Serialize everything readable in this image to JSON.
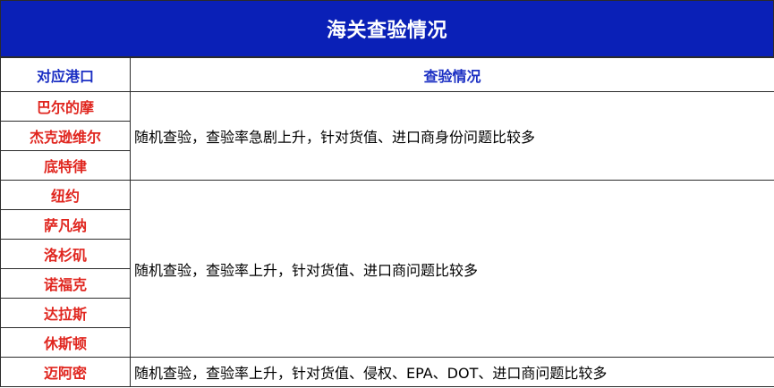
{
  "title": "海关查验情况",
  "headers": {
    "port": "对应港口",
    "situation": "查验情况"
  },
  "groups": [
    {
      "ports": [
        "巴尔的摩",
        "杰克逊维尔",
        "底特律"
      ],
      "situation": "随机查验，查验率急剧上升，针对货值、进口商身份问题比较多"
    },
    {
      "ports": [
        "纽约",
        "萨凡纳",
        "洛杉矶",
        "诺福克",
        "达拉斯",
        "休斯顿"
      ],
      "situation": "随机查验，查验率上升，针对货值、进口商问题比较多"
    },
    {
      "ports": [
        "迈阿密"
      ],
      "situation": "随机查验，查验率上升，针对货值、侵权、EPA、DOT、进口商问题比较多"
    }
  ],
  "colors": {
    "title_bg": "#0a20b7",
    "title_text": "#ffffff",
    "header_text": "#1b2fc3",
    "port_text": "#e0261f",
    "border": "#2b2b2b"
  }
}
